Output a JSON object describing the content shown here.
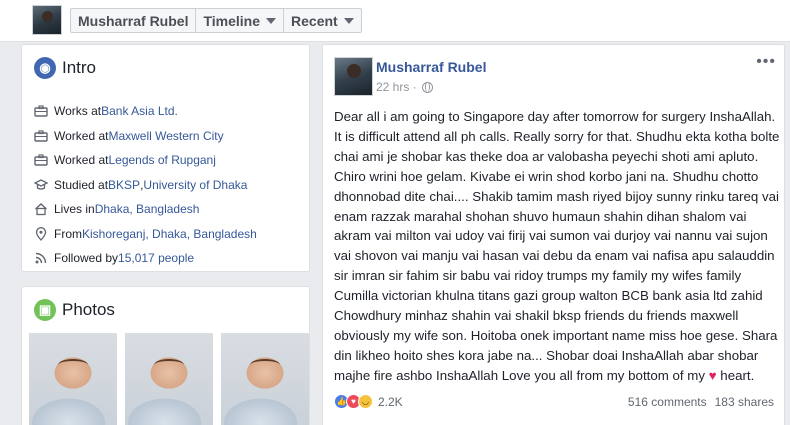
{
  "header": {
    "profile_name": "Musharraf Rubel",
    "timeline_label": "Timeline",
    "recent_label": "Recent"
  },
  "intro": {
    "title": "Intro",
    "items": [
      {
        "icon": "briefcase-icon",
        "prefix": "Works at ",
        "link": "Bank Asia Ltd.",
        "suffix": ""
      },
      {
        "icon": "briefcase-icon",
        "prefix": "Worked at ",
        "link": "Maxwell Western City",
        "suffix": ""
      },
      {
        "icon": "briefcase-icon",
        "prefix": "Worked at ",
        "link": "Legends of Rupganj",
        "suffix": ""
      },
      {
        "icon": "graduation-cap-icon",
        "prefix": "Studied at ",
        "link": "BKSP",
        "suffix": ", ",
        "link2": "University of Dhaka"
      },
      {
        "icon": "house-icon",
        "prefix": "Lives in ",
        "link": "Dhaka, Bangladesh",
        "suffix": ""
      },
      {
        "icon": "location-pin-icon",
        "prefix": "From ",
        "link": "Kishoreganj, Dhaka, Bangladesh",
        "suffix": ""
      },
      {
        "icon": "rss-icon",
        "prefix": "Followed by ",
        "link": "15,017 people",
        "suffix": ""
      }
    ]
  },
  "photos": {
    "title": "Photos"
  },
  "post": {
    "author": "Musharraf Rubel",
    "time": "22 hrs · ",
    "more": "•••",
    "text": "Dear all i am going to Singapore day after tomorrow for surgery InshaAllah. It is difficult attend all ph calls. Really sorry for that. Shudhu ekta kotha bolte chai ami je shobar kas theke doa ar valobasha peyechi shoti ami apluto. Chiro wrini hoe gelam. Kivabe ei wrin shod korbo jani na. Shudhu chotto dhonnobad dite chai.... Shakib tamim mash riyed bijoy sunny rinku tareq vai enam razzak marahal shohan shuvo humaun shahin dihan shalom vai akram vai milton vai udoy vai firij vai sumon vai durjoy vai nannu vai sujon vai shovon vai manju vai hasan vai debu da enam vai nafisa apu salauddin sir imran sir fahim sir babu vai ridoy trumps my family my wifes family Cumilla victorian khulna titans gazi group walton BCB bank asia ltd zahid Chowdhury minhaz shahin vai shakil bksp friends du friends maxwell obviously my wife son. Hoitoba onek important name miss hoe gese. Shara din likheo hoito shes kora jabe na... Shobar doai InshaAllah abar shobar majhe fire ashbo InshaAllah Love you all from my bottom of my ",
    "heart": "♥",
    "text_end": " heart.",
    "reactions_count": "2.2K",
    "comments": "516 comments",
    "shares": "183 shares"
  }
}
